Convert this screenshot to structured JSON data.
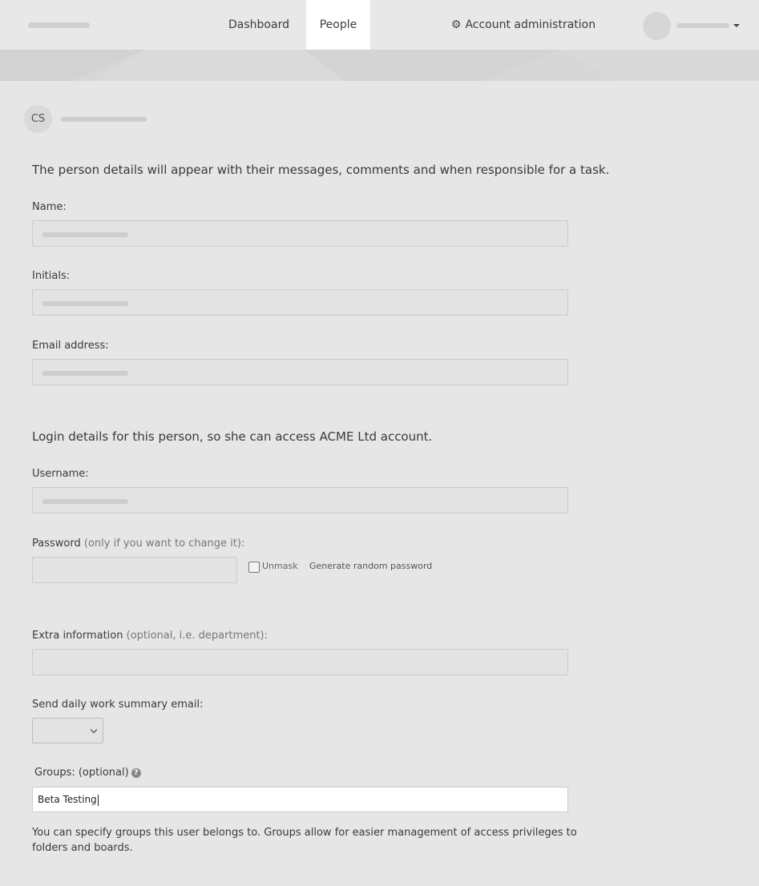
{
  "nav": {
    "dashboard": "Dashboard",
    "people": "People",
    "admin": "Account administration"
  },
  "person": {
    "initials": "CS"
  },
  "sections": {
    "details_intro": "The person details will appear with their messages, comments and when responsible for a task.",
    "login_intro": "Login details for this person, so she can access ACME Ltd account."
  },
  "fields": {
    "name_label": "Name:",
    "initials_label": "Initials:",
    "email_label": "Email address:",
    "username_label": "Username:",
    "password_label": "Password",
    "password_hint": "(only if you want to change it):",
    "unmask_label": "Unmask",
    "generate_label": "Generate random password",
    "extra_label": "Extra information",
    "extra_hint": "(optional, i.e. department):",
    "daily_summary_label": "Send daily work summary email:",
    "groups_label": "Groups: (optional)",
    "groups_value": "Beta Testing",
    "groups_help": "You can specify groups this user belongs to. Groups allow for easier management of access privileges to folders and boards."
  },
  "colors": {
    "active_tab_bg": "#ffffff",
    "page_bg": "#e6e6e6"
  }
}
